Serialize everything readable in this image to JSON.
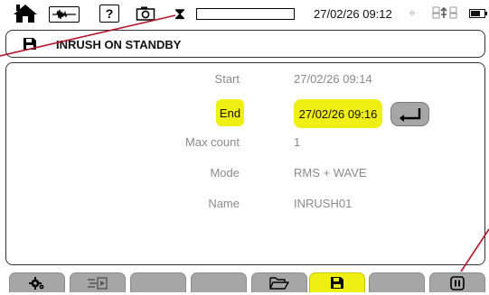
{
  "topbar": {
    "datetime": "27/02/26 09:12",
    "icons": [
      "home-icon",
      "waveform-icon",
      "help-icon",
      "camera-icon",
      "hourglass-icon",
      "gps-icon",
      "network-icon",
      "battery-icon"
    ],
    "help_symbol": "?",
    "hourglass_symbol": "⧗",
    "gps_symbol": "⌖",
    "network_symbol": "⎍⚡⎍",
    "progress_fraction": 0,
    "battery_fraction": 0.75
  },
  "title": {
    "text": "INRUSH ON STANDBY",
    "icon": "save-icon"
  },
  "form": {
    "start_label": "Start",
    "start_value": "27/02/26 09:14",
    "end_label": "End",
    "end_value": "27/02/26 09:16",
    "max_count_label": "Max count",
    "max_count_value": "1",
    "mode_label": "Mode",
    "mode_value": "RMS + WAVE",
    "name_label": "Name",
    "name_value": "INRUSH01"
  },
  "function_keys": [
    {
      "icon": "settings-icon",
      "active": false
    },
    {
      "icon": "export-icon",
      "active": false
    },
    {
      "icon": "",
      "active": false
    },
    {
      "icon": "",
      "active": false
    },
    {
      "icon": "folder-icon",
      "active": false
    },
    {
      "icon": "save-icon",
      "active": true
    },
    {
      "icon": "",
      "active": false
    },
    {
      "icon": "pause-icon",
      "active": false
    }
  ],
  "colors": {
    "highlight": "#f0ef13",
    "key_gray": "#a6a6a6",
    "annotation_line": "#b5142b",
    "muted_text": "#8a8a8a"
  }
}
